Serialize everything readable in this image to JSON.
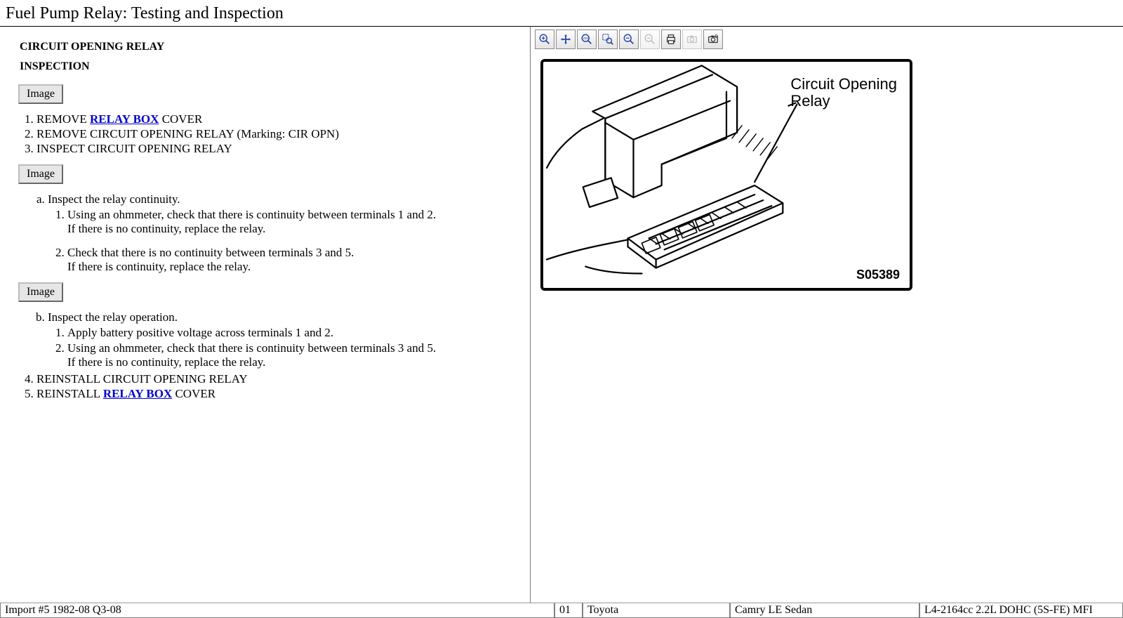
{
  "page_title": "Fuel Pump Relay:  Testing and Inspection",
  "left": {
    "h1": "CIRCUIT OPENING RELAY",
    "h2": "INSPECTION",
    "image_btn": "Image",
    "steps": {
      "s1_pre": "REMOVE ",
      "s1_link": "RELAY BOX",
      "s1_post": " COVER",
      "s2": "REMOVE CIRCUIT OPENING RELAY (Marking: CIR OPN)",
      "s3": "INSPECT CIRCUIT OPENING RELAY",
      "a_lead": "Inspect the relay continuity.",
      "a1_l1": "Using an ohmmeter, check that there is continuity between terminals 1 and 2.",
      "a1_l2": "If there is no continuity, replace the relay.",
      "a2_l1": "Check that there is no continuity between terminals 3 and 5.",
      "a2_l2": "If there is continuity, replace the relay.",
      "b_lead": "Inspect the relay operation.",
      "b1": "Apply battery positive voltage across terminals 1 and 2.",
      "b2_l1": "Using an ohmmeter, check that there is continuity between terminals 3 and 5.",
      "b2_l2": "If there is no continuity, replace the relay.",
      "s4": "REINSTALL CIRCUIT OPENING RELAY",
      "s5_pre": "REINSTALL ",
      "s5_link": "RELAY BOX",
      "s5_post": " COVER"
    }
  },
  "toolbar": {
    "zoom_in": "zoom-in-icon",
    "pan": "pan-icon",
    "zoom_100": "zoom-100-icon",
    "zoom_area": "zoom-area-icon",
    "zoom_out": "zoom-out-icon",
    "zoom_less": "zoom-less-icon",
    "print": "print-icon",
    "camera": "camera-icon",
    "camera_settings": "camera-settings-icon",
    "zoom_100_text": "100%"
  },
  "diagram": {
    "label_l1": "Circuit Opening",
    "label_l2": "Relay",
    "code": "S05389"
  },
  "status": {
    "left": "Import #5 1982-08 Q3-08",
    "year": "01",
    "make": "Toyota",
    "model": "Camry LE Sedan",
    "engine": "L4-2164cc 2.2L DOHC (5S-FE) MFI"
  }
}
